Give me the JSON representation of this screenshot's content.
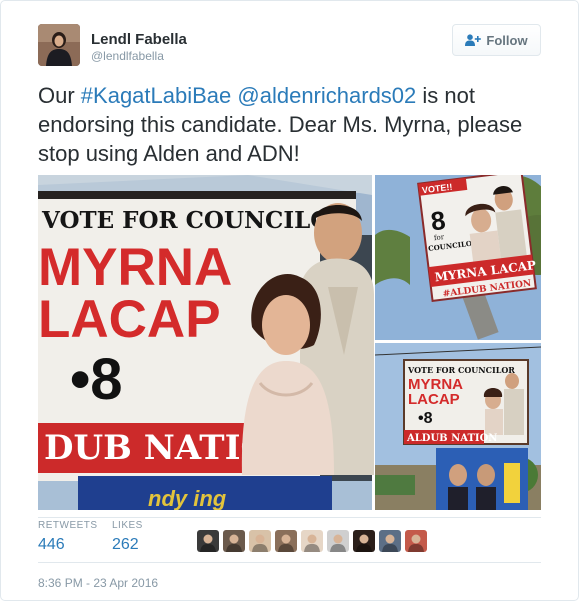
{
  "user": {
    "fullname": "Lendl Fabella",
    "handle": "@lendlfabella"
  },
  "follow_button": {
    "label": "Follow",
    "icon": "add-user-icon"
  },
  "tweet": {
    "prefix": "Our ",
    "hashtag": "#KagatLabiBae",
    "space": " ",
    "mention": "@aldenrichards02",
    "rest": " is not endorsing this candidate. Dear Ms. Myrna, please stop using Alden and ADN!"
  },
  "media": {
    "main_sign": {
      "line1": "VOTE FOR COUNCILOR",
      "line2": "MYRNA",
      "line3": "LACAP",
      "number": "•8",
      "banner": "DUB NATION"
    },
    "top_right_sign": {
      "line1": "VOTE!!",
      "number": "8",
      "line2": "for",
      "line3": "COUNCILOR",
      "name": "MYRNA LACAP",
      "banner": "#ALDUB NATION"
    },
    "bottom_right_sign": {
      "line1": "VOTE FOR COUNCILOR",
      "line2": "MYRNA",
      "line3": "LACAP",
      "number": "•8",
      "banner": "ALDUB NATION"
    },
    "bottom_strip_text": "ndy ing"
  },
  "stats": {
    "retweets_label": "RETWEETS",
    "retweets_value": "446",
    "likes_label": "LIKES",
    "likes_value": "262"
  },
  "likers": [
    "#3a3a3a",
    "#6b5a4c",
    "#d8c2a8",
    "#8a6f5a",
    "#e6d6c6",
    "#cfcfcf",
    "#2b1f1a",
    "#5c6f86",
    "#c45a4a"
  ],
  "timestamp": "8:36 PM - 23 Apr 2016"
}
